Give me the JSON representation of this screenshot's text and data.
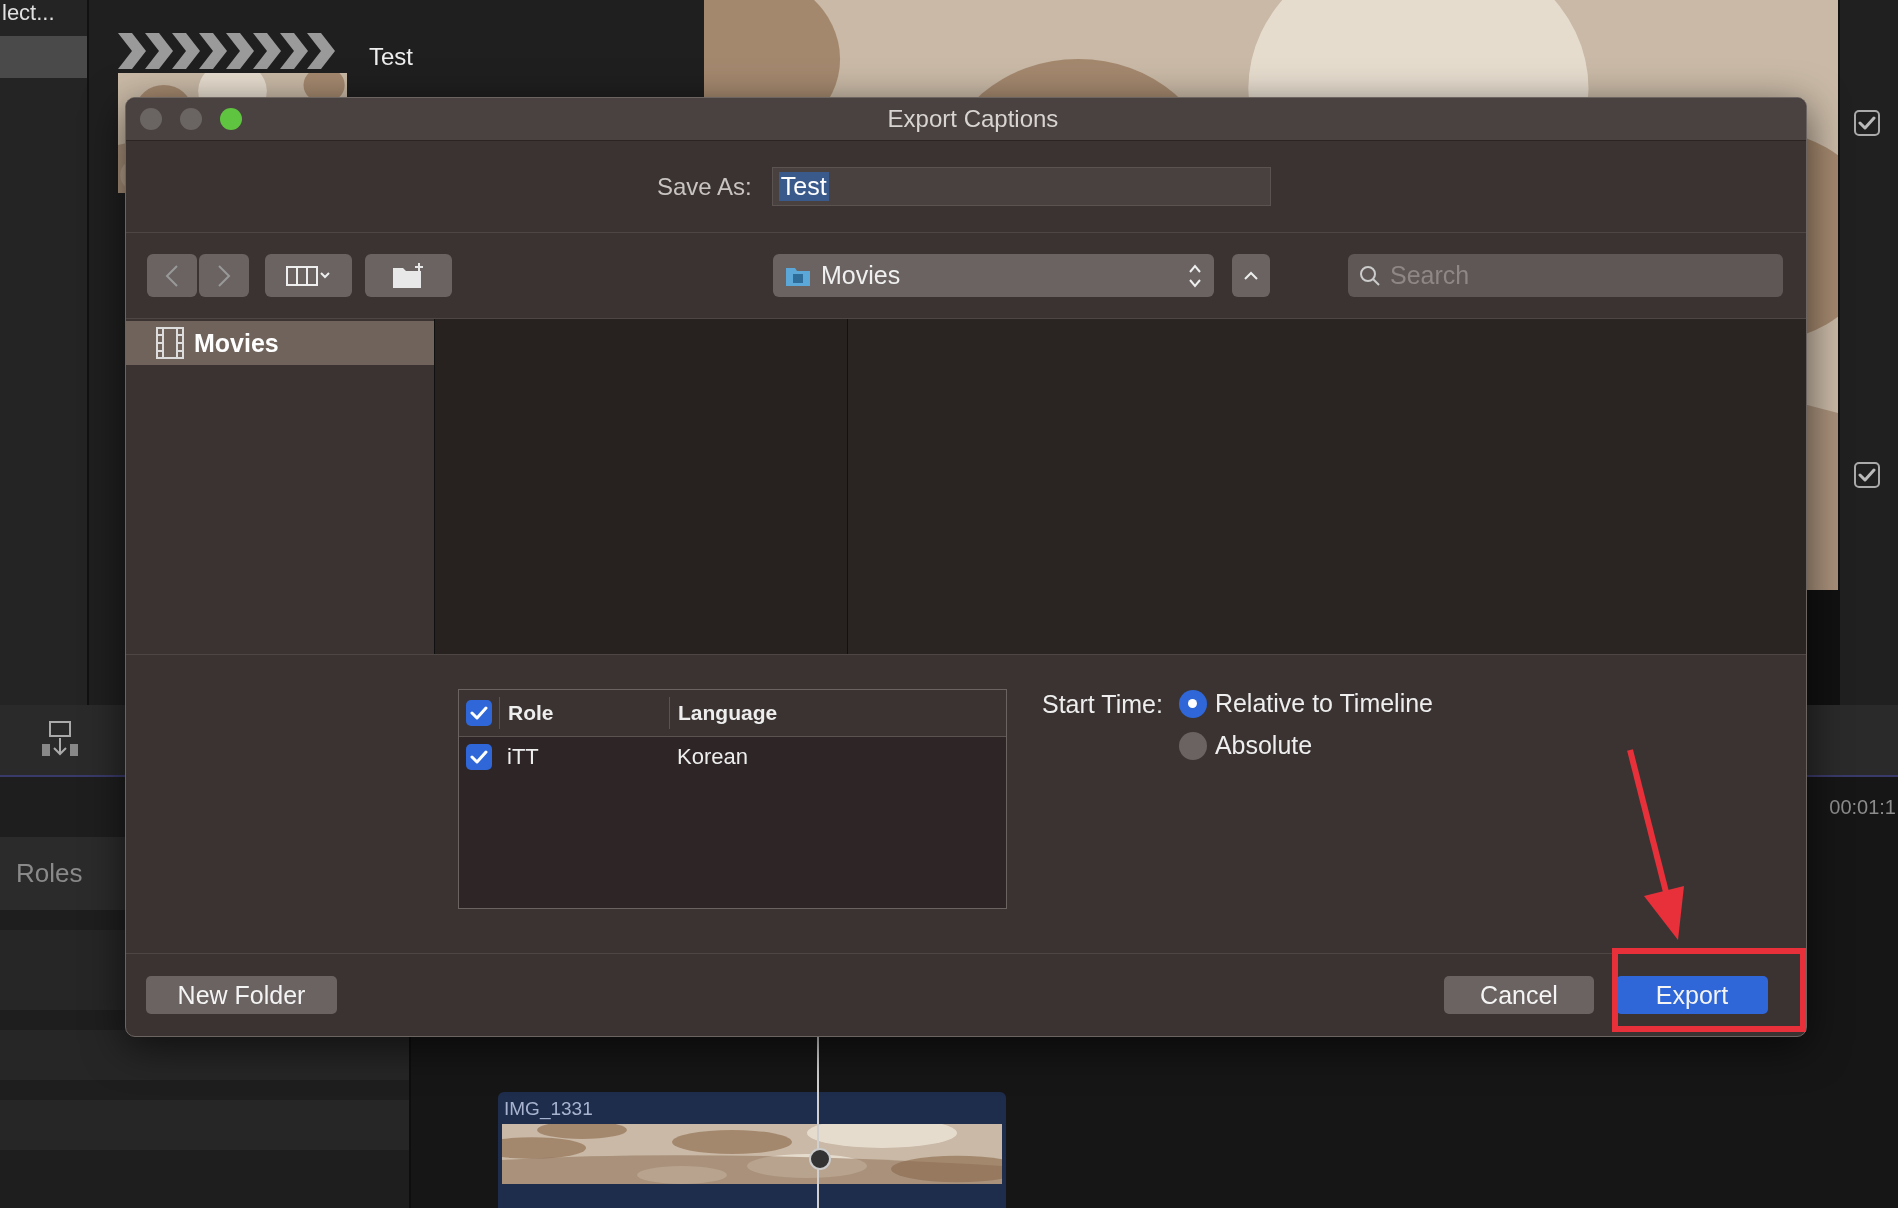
{
  "app": {
    "library_item": "lect...",
    "browser_clip_title": "Test",
    "inspector_checks": [
      {
        "checked": true
      },
      {
        "checked": true
      }
    ],
    "index_tab": "Roles",
    "timecode": "00:01:1",
    "timeline_clip": "IMG_1331"
  },
  "dialog": {
    "title": "Export Captions",
    "window_controls": [
      {
        "active": false
      },
      {
        "active": false
      },
      {
        "active": true
      }
    ],
    "save_as": {
      "label": "Save As:",
      "value": "Test",
      "value_selected": true
    },
    "location": "Movies",
    "search": {
      "placeholder": "Search"
    },
    "sidebar": [
      {
        "label": "Movies",
        "selected": true
      }
    ],
    "table": {
      "header_checked": true,
      "columns": [
        "Role",
        "Language"
      ],
      "rows": [
        {
          "checked": true,
          "cells": [
            "iTT",
            "Korean"
          ]
        }
      ]
    },
    "start_time": {
      "label": "Start Time:",
      "options": [
        {
          "label": "Relative to Timeline",
          "selected": true
        },
        {
          "label": "Absolute",
          "selected": false
        }
      ]
    },
    "buttons": {
      "new_folder": "New Folder",
      "cancel": "Cancel",
      "export": "Export"
    }
  }
}
